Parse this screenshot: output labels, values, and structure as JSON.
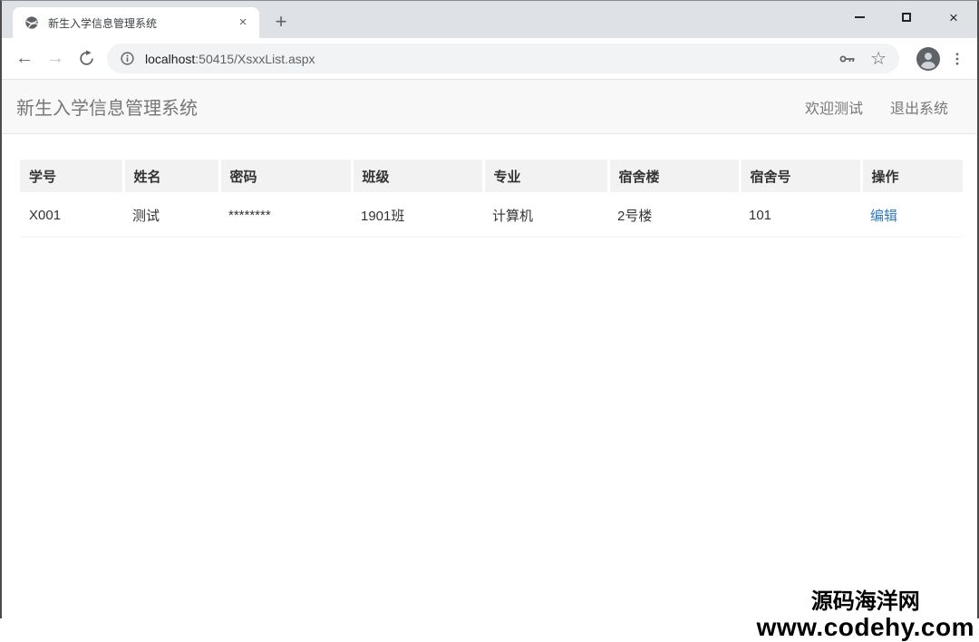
{
  "browser": {
    "tab": {
      "title": "新生入学信息管理系统",
      "close_glyph": "×",
      "new_tab_glyph": "+"
    },
    "window_controls": {
      "close_glyph": "×"
    },
    "toolbar": {
      "back_glyph": "←",
      "forward_glyph": "→",
      "star_glyph": "☆",
      "url_host": "localhost",
      "url_rest": ":50415/XsxxList.aspx",
      "url_full": "localhost:50415/XsxxList.aspx"
    }
  },
  "page": {
    "navbar": {
      "brand": "新生入学信息管理系统",
      "welcome_text": "欢迎测试",
      "logout_label": "退出系统"
    },
    "table": {
      "headers": [
        "学号",
        "姓名",
        "密码",
        "班级",
        "专业",
        "宿舍楼",
        "宿舍号",
        "操作"
      ],
      "rows": [
        {
          "cells": [
            "X001",
            "测试",
            "********",
            "1901班",
            "计算机",
            "2号楼",
            "101"
          ],
          "action_label": "编辑"
        }
      ]
    }
  },
  "watermark": {
    "line1": "源码海洋网",
    "line2": "www.codehy.com"
  },
  "icons": {
    "favicon": "globe-icon",
    "tab_close": "close-icon",
    "new_tab": "plus-icon",
    "minimize": "minimize-icon",
    "maximize": "maximize-icon",
    "window_close": "close-icon",
    "back": "arrow-left-icon",
    "forward": "arrow-right-icon",
    "reload": "reload-icon",
    "page_info": "info-circle-icon",
    "password_key": "key-icon",
    "bookmark": "star-icon",
    "profile": "avatar-person-icon",
    "menu": "three-dot-menu-icon"
  },
  "colors": {
    "tabstrip_bg": "#dee1e6",
    "omnibox_bg": "#f1f3f4",
    "icon_gray": "#5f6368",
    "navbar_bg": "#f8f8f8",
    "navbar_text": "#777777",
    "table_header_bg": "#f2f2f2",
    "link_blue": "#337ab7",
    "watermark_text": "#000000"
  }
}
